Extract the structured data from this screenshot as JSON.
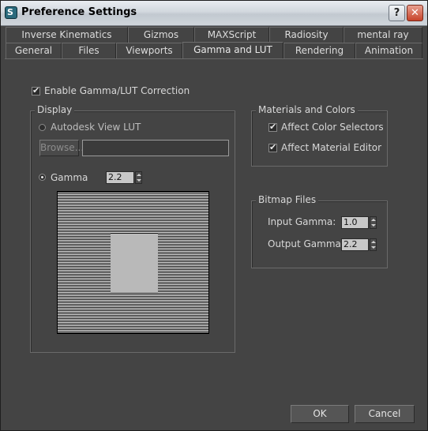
{
  "window": {
    "title": "Preference Settings",
    "app_icon_glyph": "S",
    "help_label": "?",
    "close_label": "✕"
  },
  "tabs_row1": [
    "Inverse Kinematics",
    "Gizmos",
    "MAXScript",
    "Radiosity",
    "mental ray"
  ],
  "tabs_row2": [
    "General",
    "Files",
    "Viewports",
    "Gamma and LUT",
    "Rendering",
    "Animation"
  ],
  "active_tab": "Gamma and LUT",
  "enable_gamma": {
    "label": "Enable Gamma/LUT Correction",
    "checked": true
  },
  "display": {
    "title": "Display",
    "lut_option": {
      "label": "Autodesk View LUT",
      "selected": false
    },
    "browse_label": "Browse...",
    "lut_path": "",
    "gamma_option": {
      "label": "Gamma",
      "selected": true
    },
    "gamma_value": "2.2"
  },
  "materials": {
    "title": "Materials and Colors",
    "affect_color_selectors": {
      "label": "Affect Color Selectors",
      "checked": true
    },
    "affect_material_editor": {
      "label": "Affect Material Editor",
      "checked": true
    }
  },
  "bitmap": {
    "title": "Bitmap Files",
    "input_label": "Input Gamma:",
    "input_value": "1.0",
    "output_label": "Output Gamma:",
    "output_value": "2.2"
  },
  "footer": {
    "ok_label": "OK",
    "cancel_label": "Cancel"
  },
  "check_glyph": "✔"
}
